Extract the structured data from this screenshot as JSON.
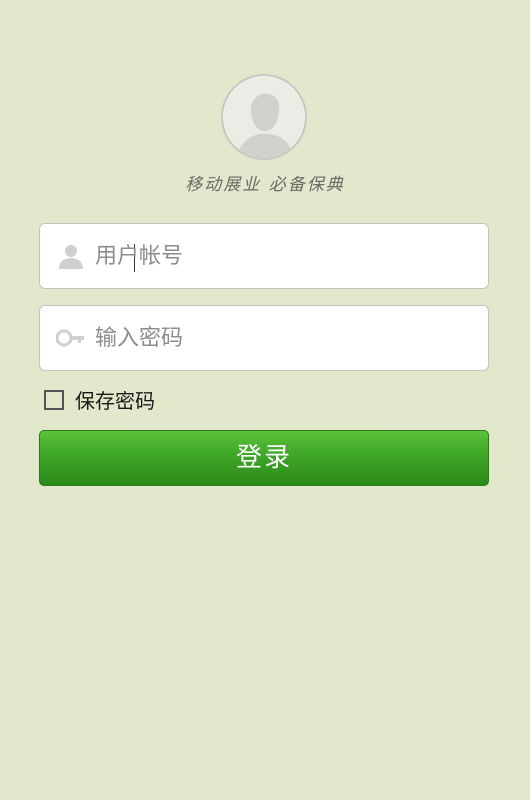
{
  "header": {
    "avatar_icon": "default-user-avatar-icon",
    "slogan": "移动展业 必备保典"
  },
  "form": {
    "username": {
      "placeholder": "用户帐号",
      "value": "",
      "icon": "person-icon"
    },
    "password": {
      "placeholder": "输入密码",
      "value": "",
      "icon": "key-icon"
    },
    "save_password": {
      "label": "保存密码",
      "checked": false
    },
    "login_button": {
      "label": "登录"
    }
  },
  "colors": {
    "background": "#e2e8cb",
    "button_green": "#3ea628"
  }
}
